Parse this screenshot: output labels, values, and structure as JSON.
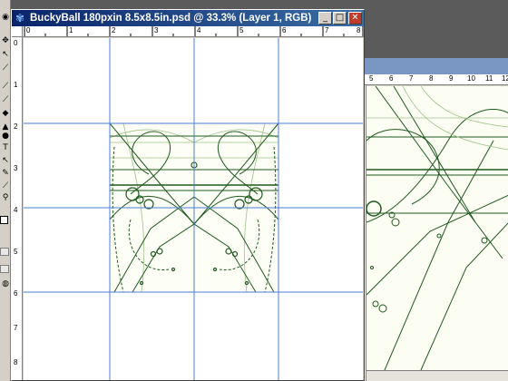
{
  "main_window": {
    "title": "BuckyBall 180pxin 8.5x8.5in.psd @ 33.3% (Layer 1, RGB)",
    "buttons": {
      "minimize": "_",
      "maximize": "□",
      "close": "✕"
    },
    "h_ruler_labels": [
      "0",
      "1",
      "2",
      "3",
      "4",
      "5",
      "6",
      "7",
      "8"
    ],
    "v_ruler_labels": [
      "0",
      "1",
      "2",
      "3",
      "4",
      "5",
      "6",
      "7",
      "8"
    ]
  },
  "bg_window": {
    "h_ruler_labels": [
      "5",
      "6",
      "7",
      "8",
      "9",
      "10",
      "11",
      "12"
    ]
  },
  "toolbox": {
    "tools": [
      "move-icon",
      "lasso-icon",
      "crop-icon",
      "brush-icon",
      "stamp-icon",
      "eraser-icon",
      "gradient-icon",
      "dodge-icon",
      "pen-icon",
      "type-icon",
      "path-select-icon",
      "shape-icon",
      "notes-icon",
      "eyedropper-icon",
      "hand-icon",
      "zoom-icon"
    ]
  },
  "colors": {
    "guide": "#4a7fd6",
    "artwork": "#1f5a1f",
    "artwork_light": "#9fc28a",
    "titlebar_start": "#0a246a",
    "titlebar_end": "#3a6ea5"
  }
}
